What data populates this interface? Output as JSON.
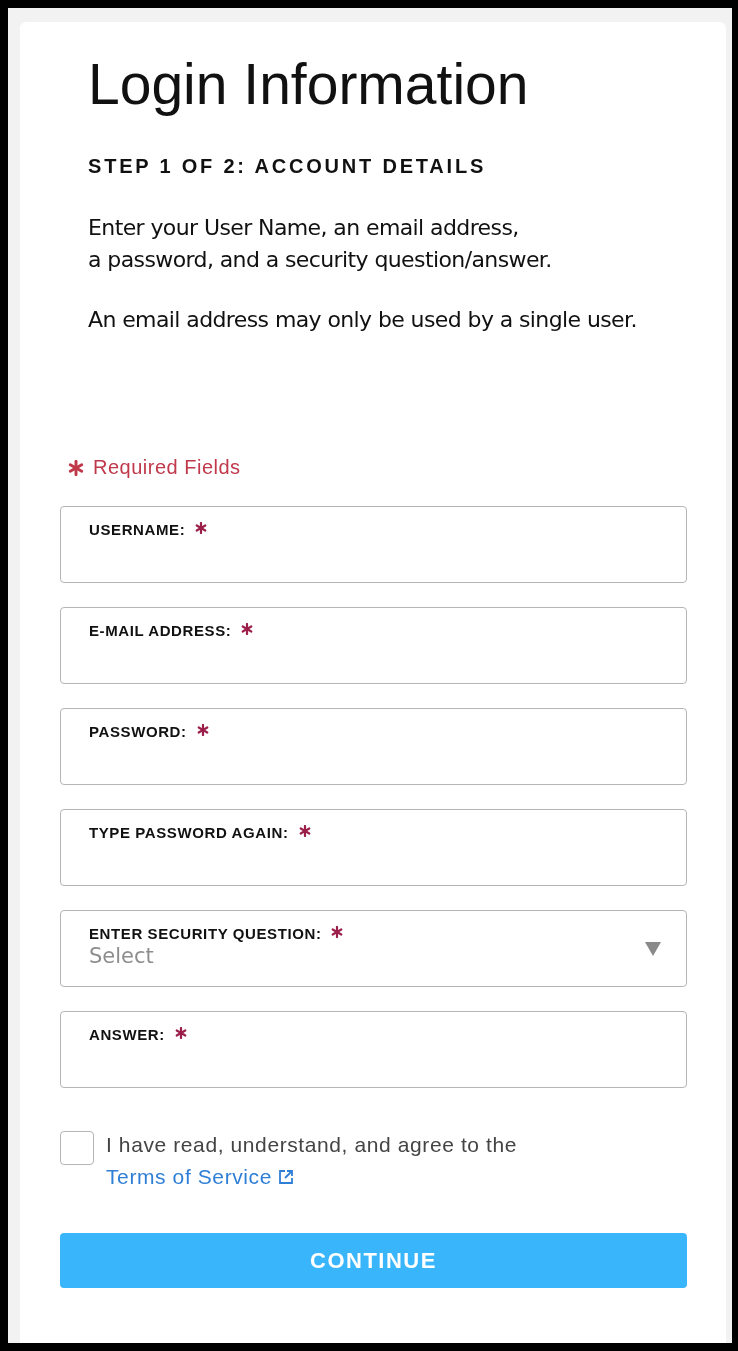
{
  "title": "Login Information",
  "step": "STEP 1 OF 2: ACCOUNT DETAILS",
  "paragraphs": [
    "Enter your User Name, an email address,\na password, and a security question/answer.",
    "An email address may only be used by a single user."
  ],
  "required_note": "Required Fields",
  "fields": [
    {
      "kind": "text",
      "label": "USERNAME:",
      "required": true
    },
    {
      "kind": "text",
      "label": "E-MAIL ADDRESS:",
      "required": true
    },
    {
      "kind": "text",
      "label": "PASSWORD:",
      "required": true
    },
    {
      "kind": "text",
      "label": "TYPE PASSWORD AGAIN:",
      "required": true
    },
    {
      "kind": "select",
      "label": "ENTER SECURITY QUESTION:",
      "required": true,
      "placeholder": "Select"
    },
    {
      "kind": "text",
      "label": "ANSWER:",
      "required": true
    }
  ],
  "agreement": {
    "checked": false,
    "text": "I have read, understand, and agree to the ",
    "link": "Terms of Service"
  },
  "button": "CONTINUE"
}
